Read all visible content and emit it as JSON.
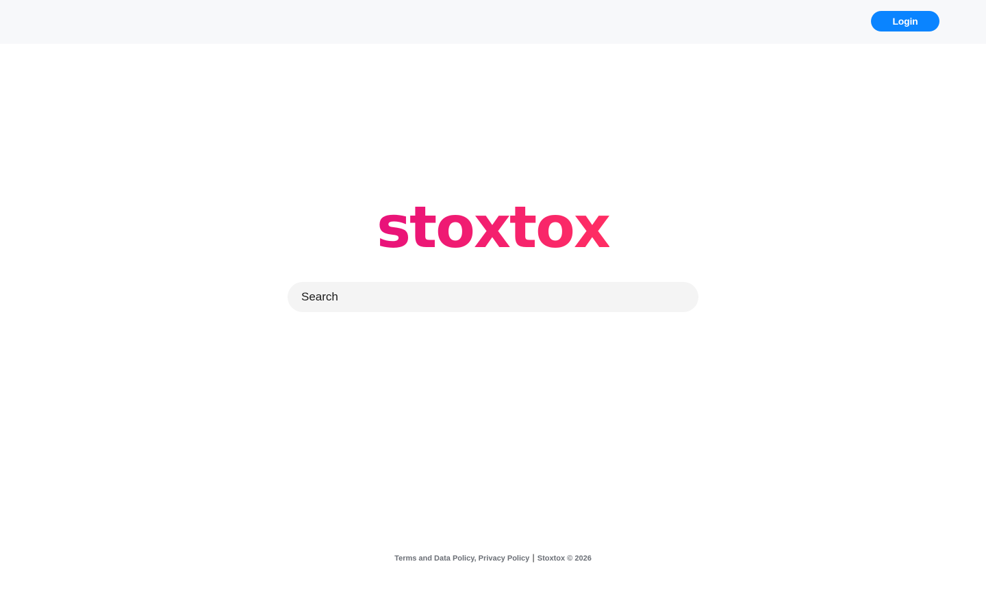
{
  "header": {
    "login_label": "Login"
  },
  "brand": {
    "logo_text": "stoxtox",
    "gradient_start": "#e8127a",
    "gradient_end": "#ff2e63"
  },
  "search": {
    "placeholder": "Search",
    "value": ""
  },
  "footer": {
    "terms_label": "Terms and Data Policy",
    "comma": ",",
    "privacy_label": "Privacy Policy",
    "separator": "|",
    "copyright": "Stoxtox © 2026"
  },
  "colors": {
    "accent": "#0a84ff",
    "topbar_bg": "#f7f8fa",
    "search_bg": "#f4f4f4"
  }
}
